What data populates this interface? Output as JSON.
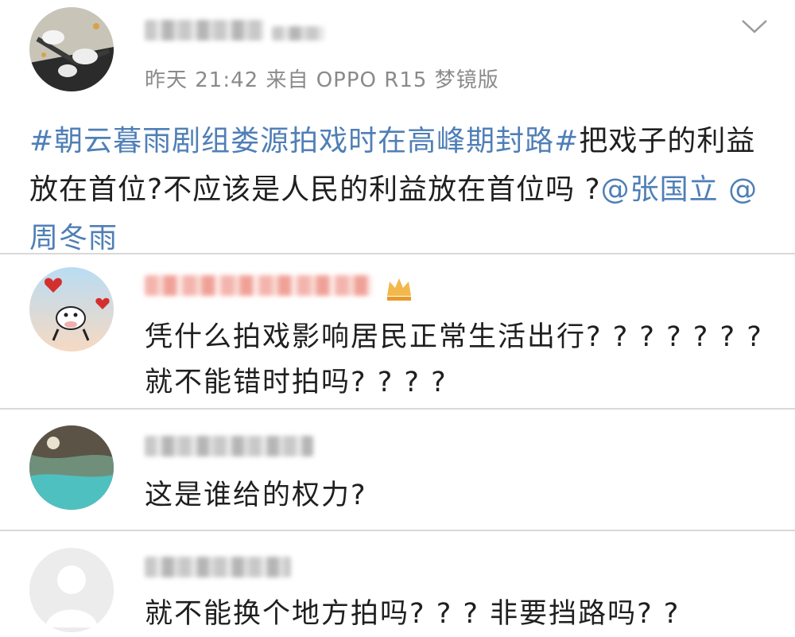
{
  "post": {
    "meta": "昨天 21:42  来自 OPPO R15 梦镜版",
    "topic": "#朝云暮雨剧组娄源拍戏时在高峰期封路#",
    "text": "把戏子的利益放在首位?不应该是人民的利益放在首位吗 ?",
    "mentions": [
      "@张国立",
      "@周冬雨"
    ]
  },
  "comments": [
    {
      "text": "凭什么拍戏影响居民正常生活出行? ? ? ? ? ? ?  就不能错时拍吗? ? ? ?"
    },
    {
      "text": "这是谁给的权力?"
    },
    {
      "text": "就不能换个地方拍吗? ? ?  非要挡路吗? ?"
    }
  ],
  "icons": {
    "expand": "chevron-down-icon",
    "vip_badge": "crown-icon",
    "default_avatar": "user-silhouette-icon"
  },
  "colors": {
    "link": "#4f7fb6",
    "meta": "#8a8a8a",
    "divider": "#d9d9d9"
  }
}
